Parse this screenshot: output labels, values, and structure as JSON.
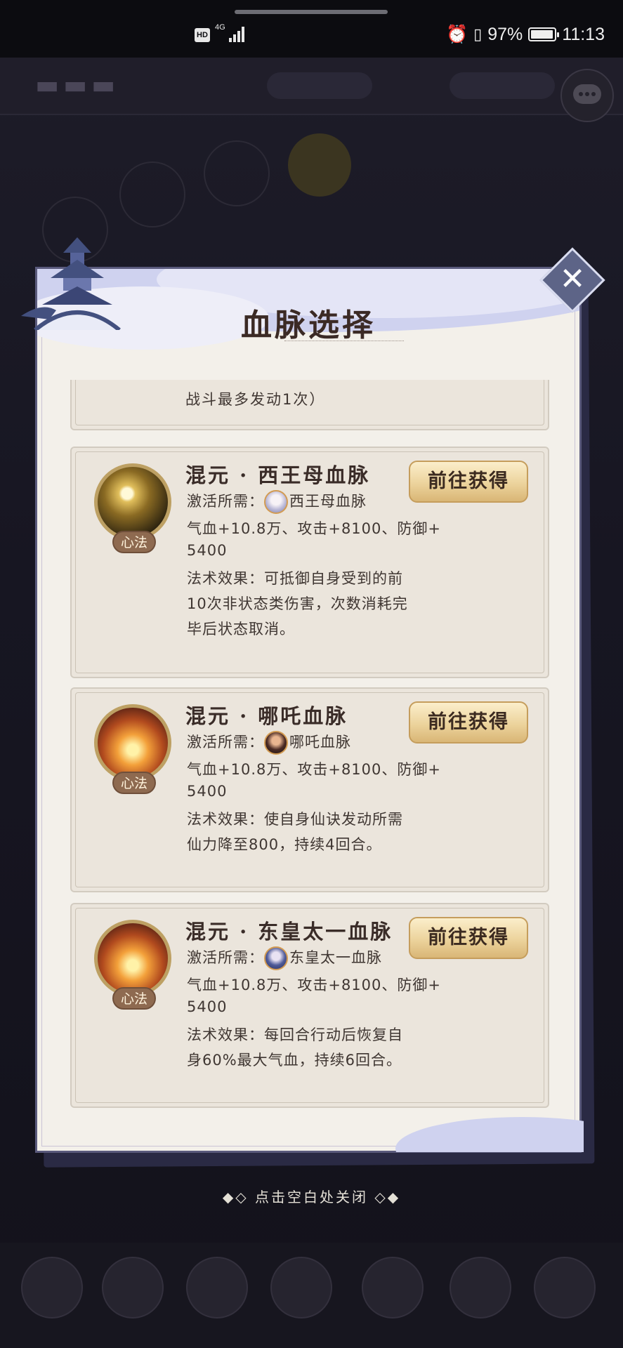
{
  "status_bar": {
    "hd": "HD",
    "network": "4G",
    "battery_percent": "97%",
    "battery_level": 0.97,
    "time": "11:13"
  },
  "dialog": {
    "title": "血脉选择",
    "partial_text": "战斗最多发动1次）",
    "cards": [
      {
        "title": "混元 · 西王母血脉",
        "badge": "心法",
        "orb_icon": "moon-orb-icon",
        "req_label": "激活所需：",
        "req_name": "西王母血脉",
        "stat_line1": "气血+10.8万、攻击+8100、防御+",
        "stat_line2": "5400",
        "effect_lines": [
          "法术效果：可抵御自身受到的前",
          "10次非状态类伤害，次数消耗完",
          "毕后状态取消。"
        ],
        "button": "前往获得"
      },
      {
        "title": "混元 · 哪吒血脉",
        "badge": "心法",
        "orb_icon": "flame-orb-icon",
        "req_label": "激活所需：",
        "req_name": "哪吒血脉",
        "stat_line1": "气血+10.8万、攻击+8100、防御+",
        "stat_line2": "5400",
        "effect_lines": [
          "法术效果：使自身仙诀发动所需",
          "仙力降至800，持续4回合。"
        ],
        "button": "前往获得"
      },
      {
        "title": "混元 · 东皇太一血脉",
        "badge": "心法",
        "orb_icon": "flame-orb-icon",
        "req_label": "激活所需：",
        "req_name": "东皇太一血脉",
        "stat_line1": "气血+10.8万、攻击+8100、防御+",
        "stat_line2": "5400",
        "effect_lines": [
          "法术效果：每回合行动后恢复自",
          "身60%最大气血，持续6回合。"
        ],
        "button": "前往获得"
      }
    ]
  },
  "close_hint": "◆◇ 点击空白处关闭 ◇◆"
}
